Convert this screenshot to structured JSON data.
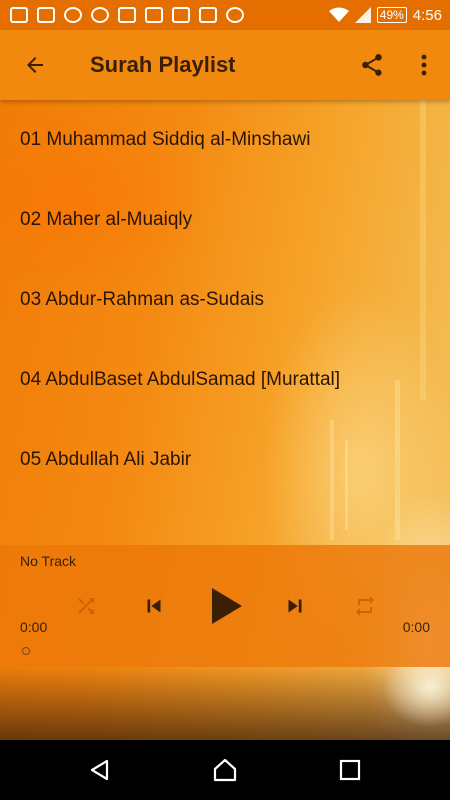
{
  "status_bar": {
    "battery": "49%",
    "time": "4:56"
  },
  "app_bar": {
    "title": "Surah Playlist"
  },
  "playlist": [
    {
      "label": "01 Muhammad Siddiq al-Minshawi"
    },
    {
      "label": "02 Maher al-Muaiqly"
    },
    {
      "label": "03 Abdur-Rahman as-Sudais"
    },
    {
      "label": "04 AbdulBaset AbdulSamad [Murattal]"
    },
    {
      "label": "05 Abdullah Ali Jabir"
    }
  ],
  "player": {
    "now_playing": "No Track",
    "elapsed": "0:00",
    "duration": "0:00"
  },
  "icons": {
    "back": "arrow-left-icon",
    "share": "share-icon",
    "overflow": "more-vertical-icon",
    "shuffle": "shuffle-icon",
    "previous": "skip-previous-icon",
    "play": "play-icon",
    "next": "skip-next-icon",
    "repeat": "repeat-icon"
  },
  "colors": {
    "status_bar": "#e46f00",
    "app_bar": "#f2890f",
    "player_bg": "#ec7808",
    "text_dark": "#2a1505"
  }
}
